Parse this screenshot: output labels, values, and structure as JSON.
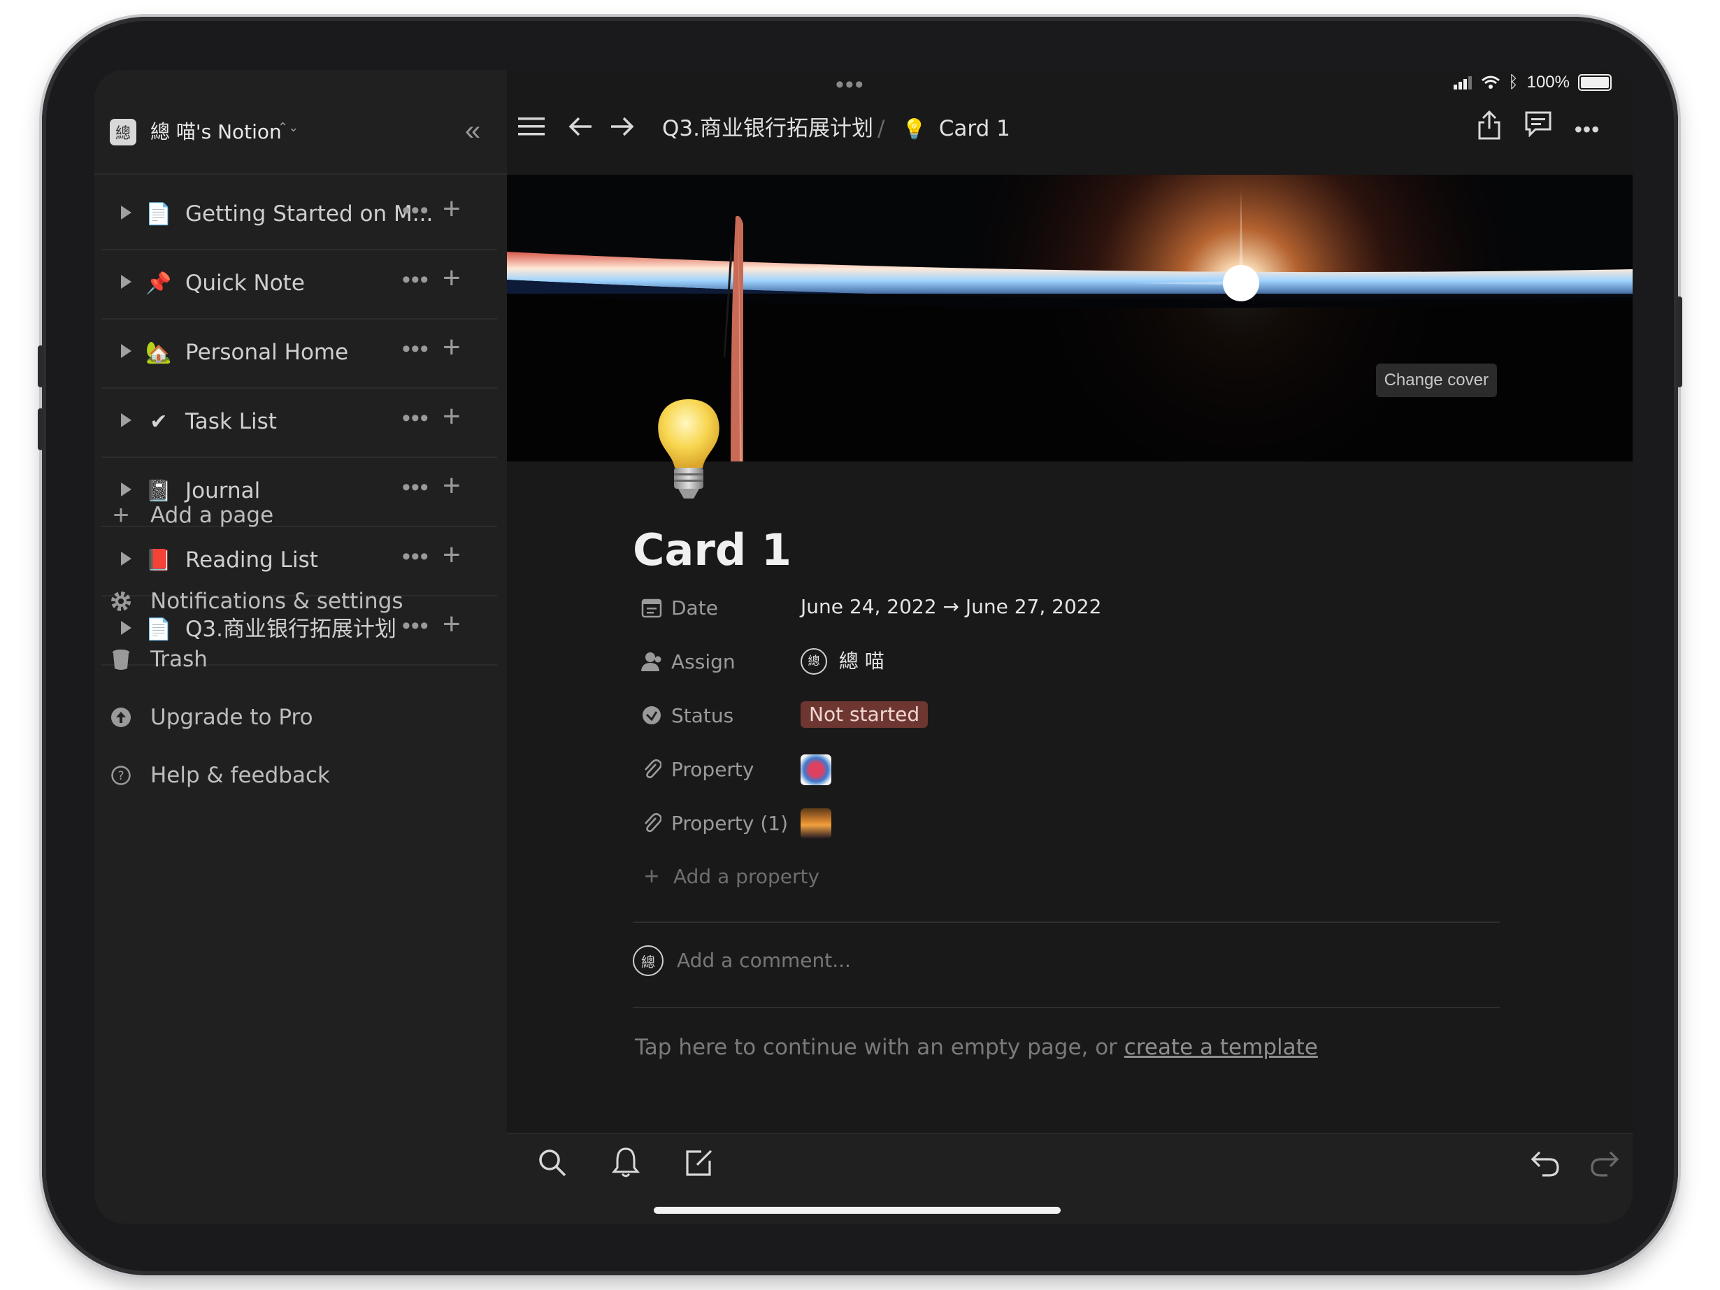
{
  "workspace": {
    "avatar_glyph": "總",
    "name": "總 喵's Notion",
    "switch_caret": "⌃⌄",
    "collapse_icon": "«"
  },
  "sidebar": {
    "pages": [
      {
        "label": "Getting Started on M...",
        "icon": "document-icon",
        "glyph": "📄"
      },
      {
        "label": "Quick Note",
        "icon": "pushpin-icon",
        "glyph": "📌"
      },
      {
        "label": "Personal Home",
        "icon": "house-icon",
        "glyph": "🏡"
      },
      {
        "label": "Task List",
        "icon": "checkmark-icon",
        "glyph": "✔"
      },
      {
        "label": "Journal",
        "icon": "notebook-icon",
        "glyph": "📓"
      },
      {
        "label": "Reading List",
        "icon": "red-book-icon",
        "glyph": "📕"
      },
      {
        "label": "Q3.商业银行拓展计划",
        "icon": "document-icon",
        "glyph": "📄"
      }
    ],
    "more_glyph": "•••",
    "add_glyph": "+",
    "add_page": "Add a page",
    "links": [
      {
        "label": "Notifications & settings",
        "icon": "gear-icon"
      },
      {
        "label": "Trash",
        "icon": "trash-icon"
      },
      {
        "label": "Upgrade to Pro",
        "icon": "upgrade-icon"
      },
      {
        "label": "Help & feedback",
        "icon": "help-icon"
      }
    ]
  },
  "status_bar": {
    "battery": "100%"
  },
  "topbar": {
    "breadcrumb_parent": "Q3.商业银行拓展计划",
    "breadcrumb_sep": "/",
    "breadcrumb_current": "Card 1"
  },
  "page": {
    "change_cover": "Change cover",
    "title": "Card 1",
    "properties": [
      {
        "name": "Date",
        "icon": "calendar-icon",
        "value": "June 24, 2022 → June 27, 2022"
      },
      {
        "name": "Assign",
        "icon": "person-icon",
        "value": "總 喵"
      },
      {
        "name": "Status",
        "icon": "status-icon",
        "value": "Not started"
      },
      {
        "name": "Property",
        "icon": "paperclip-icon",
        "value": ""
      },
      {
        "name": "Property (1)",
        "icon": "paperclip-icon",
        "value": ""
      }
    ],
    "add_property": "Add a property",
    "comment_placeholder": "Add a comment...",
    "empty_hint": "Tap here to continue with an empty page, or ",
    "template_link": "create a template"
  },
  "colors": {
    "background": "#191919",
    "sidebar": "#202020",
    "status_pill": "#6e3630"
  }
}
